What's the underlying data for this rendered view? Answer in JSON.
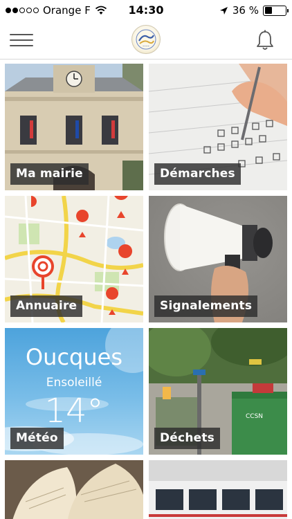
{
  "status_bar": {
    "carrier": "Orange F",
    "time": "14:30",
    "battery_text": "36 %",
    "battery_level": 0.36,
    "signal_bars": 2,
    "signal_total": 5
  },
  "nav": {
    "menu_icon": "hamburger-menu-icon",
    "logo_icon": "town-logo-icon",
    "notification_icon": "bell-icon"
  },
  "tiles": [
    {
      "label": "Ma mairie"
    },
    {
      "label": "Démarches"
    },
    {
      "label": "Annuaire"
    },
    {
      "label": "Signalements"
    },
    {
      "label": "Météo"
    },
    {
      "label": "Déchets"
    }
  ],
  "weather": {
    "city": "Oucques",
    "condition": "Ensoleillé",
    "temperature": "14°"
  },
  "waste_container_text": "CCSN",
  "colors": {
    "label_bg": "#2d2d2d",
    "map_pin": "#e8452c",
    "divider": "#d9d9d9"
  }
}
